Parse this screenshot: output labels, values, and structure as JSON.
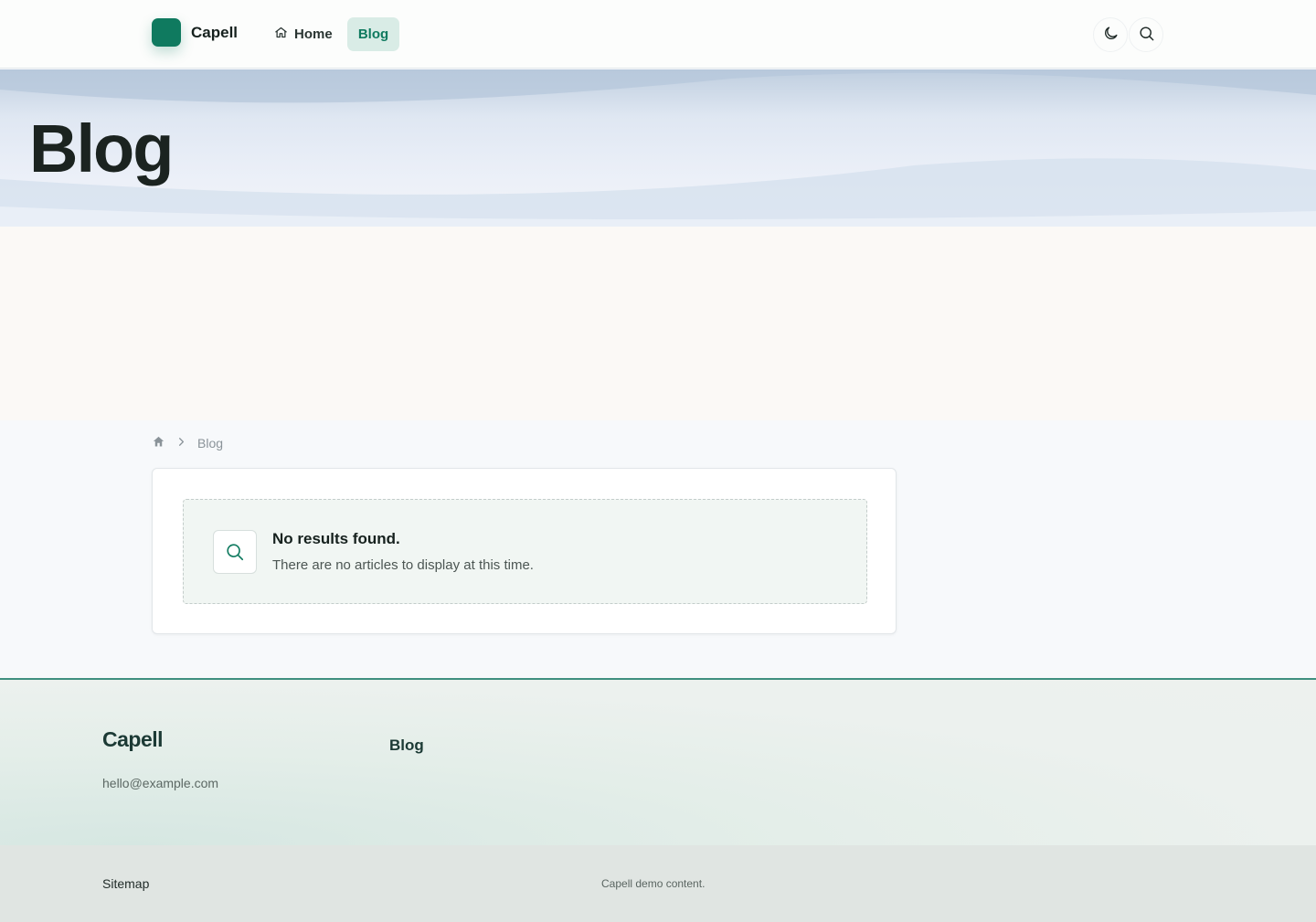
{
  "header": {
    "brand": "Capell",
    "nav": [
      {
        "label": "Home",
        "icon": "home-icon"
      },
      {
        "label": "Blog",
        "active": true
      }
    ],
    "actions": [
      {
        "icon": "moon-icon"
      },
      {
        "icon": "search-icon"
      }
    ]
  },
  "hero": {
    "title": "Blog"
  },
  "breadcrumb": {
    "home_icon": "home-icon",
    "separator_icon": "chevron-right-icon",
    "current": "Blog"
  },
  "empty_state": {
    "icon": "search-icon",
    "title": "No results found.",
    "message": "There are no articles to display at this time."
  },
  "footer": {
    "brand": "Capell",
    "email": "hello@example.com",
    "column_heading": "Blog",
    "sitemap": "Sitemap",
    "copyright": "Capell demo content."
  },
  "colors": {
    "brand": "#0f7a5f",
    "nav_active_bg": "#d9ece6",
    "footer_border": "#3f8f7f",
    "page_bg": "#f7f9fb"
  }
}
